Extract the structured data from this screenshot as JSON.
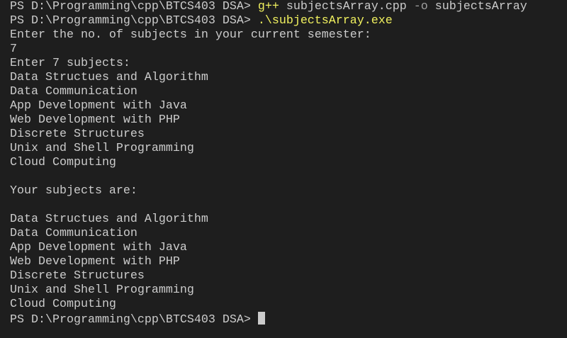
{
  "terminal": {
    "prompt": "PS D:\\Programming\\cpp\\BTCS403 DSA>",
    "colors": {
      "background": "#1e1e1e",
      "text": "#cccccc",
      "command": "#f1f15f",
      "flag": "#9e9e9e"
    },
    "command1": {
      "program": "g++",
      "file": "subjectsArray.cpp",
      "flag": "-o",
      "output": "subjectsArray"
    },
    "command2": ".\\subjectsArray.exe",
    "ask_count": "Enter the no. of subjects in your current semester:",
    "count_input": "7",
    "ask_subjects": "Enter 7 subjects:",
    "inputs": [
      "Data Structues and Algorithm",
      "Data Communication",
      "App Development with Java",
      "Web Development with PHP",
      "Discrete Structures",
      "Unix and Shell Programming",
      "Cloud Computing"
    ],
    "result_header": "Your subjects are:",
    "outputs": [
      "Data Structues and Algorithm",
      "Data Communication",
      "App Development with Java",
      "Web Development with PHP",
      "Discrete Structures",
      "Unix and Shell Programming",
      "Cloud Computing"
    ]
  }
}
